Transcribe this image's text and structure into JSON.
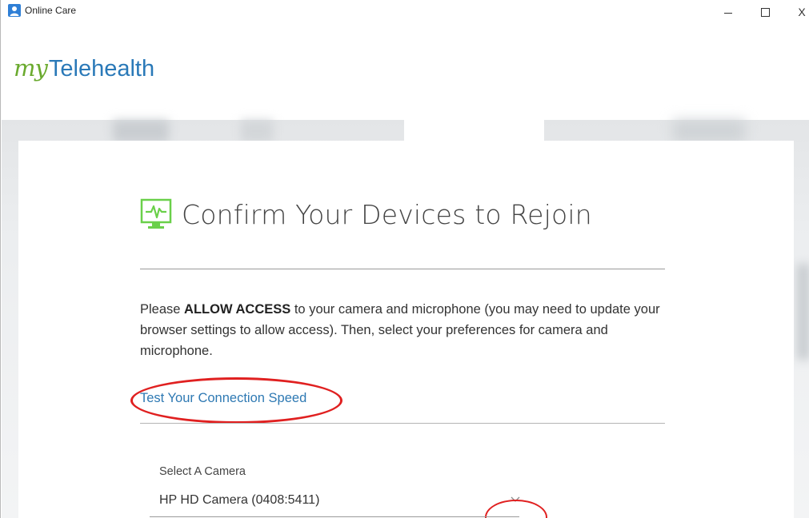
{
  "window": {
    "title": "Online Care",
    "minimize_glyph": "—",
    "maximize_glyph": "☐",
    "close_glyph": "X"
  },
  "brand": {
    "prefix": "my",
    "name": "Telehealth",
    "colors": {
      "prefix": "#6aaa2e",
      "name": "#2a79b8"
    }
  },
  "page": {
    "heading": "Confirm Your Devices to Rejoin",
    "heading_icon": "monitor-pulse-icon",
    "instructions": {
      "before": "Please ",
      "bold": "ALLOW ACCESS",
      "after": " to your camera and microphone (you may need to update your browser settings to allow access). Then, select your preferences for camera and microphone."
    },
    "test_link": "Test Your Connection Speed",
    "camera": {
      "label": "Select A Camera",
      "selected": "HP HD Camera (0408:5411)"
    },
    "annotation_color": "#e02020",
    "link_color": "#2e79b3",
    "accent_green": "#6ad04a"
  }
}
